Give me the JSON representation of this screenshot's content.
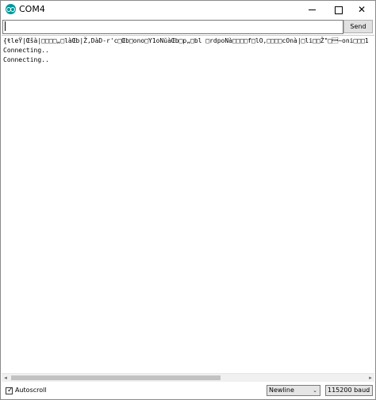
{
  "window": {
    "title": "COM4",
    "icon": "arduino-icon",
    "controls": {
      "minimize": "minimize-icon",
      "maximize": "maximize-icon",
      "close": "✕"
    }
  },
  "input": {
    "value": "",
    "send_label": "Send"
  },
  "output": {
    "lines": [
      "{ŧleŸ|Œŝà|□□□□„□làŒb|Ž,DàD-r'c□Œb□ono□Y1oNŭàŒb□p„□bl □rdpoNà□□□□f□lO,□□□□cOnà|□li□□Ž\"□\u0001~oni□□□1",
      "Connecting..",
      "Connecting.."
    ]
  },
  "footer": {
    "autoscroll_label": "Autoscroll",
    "autoscroll_checked": "✓",
    "line_ending": "Newline",
    "baud_rate": "115200 baud",
    "dropdown_arrow": "⌄"
  },
  "colors": {
    "accent": "#00979c",
    "border": "#7a7a7a"
  }
}
